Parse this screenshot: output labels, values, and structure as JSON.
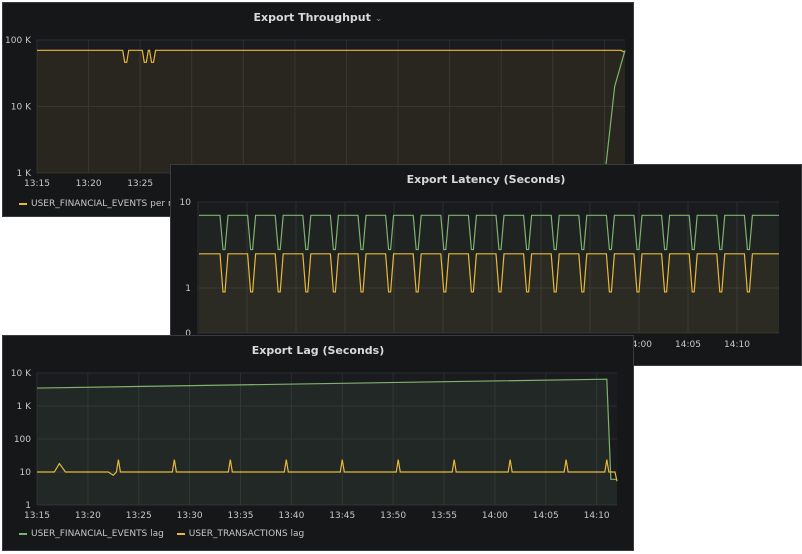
{
  "panels": {
    "throughput": {
      "title": "Export Throughput",
      "legend": [
        "USER_FINANCIAL_EVENTS per min"
      ]
    },
    "latency": {
      "title": "Export Latency (Seconds)",
      "legend": []
    },
    "lag": {
      "title": "Export Lag (Seconds)",
      "legend": [
        "USER_FINANCIAL_EVENTS lag",
        "USER_TRANSACTIONS lag"
      ]
    }
  },
  "colors": {
    "panel_bg": "#161719",
    "grid": "#2c2d30",
    "green": "#7eb26d",
    "yellow": "#eab839"
  },
  "chart_data": [
    {
      "type": "line",
      "title": "Export Throughput",
      "y_scale": "log",
      "ylim": [
        1000,
        100000
      ],
      "y_ticks": [
        "1 K",
        "10 K",
        "100 K"
      ],
      "x_ticks": [
        "13:15",
        "13:20",
        "13:25"
      ],
      "series": [
        {
          "name": "USER_FINANCIAL_EVENTS per min",
          "color": "#eab839",
          "x": [
            "13:15",
            "13:20",
            "13:25",
            "13:30",
            "13:35",
            "13:40",
            "13:45",
            "13:50",
            "13:55",
            "14:00",
            "14:05",
            "14:10",
            "14:11",
            "14:12"
          ],
          "values": [
            70000,
            70000,
            70000,
            70000,
            70000,
            70000,
            70000,
            70000,
            70000,
            70000,
            70000,
            70000,
            70000,
            70000
          ]
        },
        {
          "name": "",
          "color": "#7eb26d",
          "x": [
            "14:10",
            "14:11",
            "14:12"
          ],
          "values": [
            800,
            20000,
            70000
          ]
        }
      ]
    },
    {
      "type": "line",
      "title": "Export Latency (Seconds)",
      "y_scale": "log",
      "ylim": [
        0.3,
        10
      ],
      "y_ticks": [
        "0",
        "1",
        "10"
      ],
      "x_ticks": [
        "14:00",
        "14:05",
        "14:10"
      ],
      "series": [
        {
          "name": "",
          "color": "#7eb26d",
          "baseline": 7,
          "dip": 2.8
        },
        {
          "name": "",
          "color": "#eab839",
          "baseline": 2.5,
          "dip": 0.9
        }
      ]
    },
    {
      "type": "line",
      "title": "Export Lag (Seconds)",
      "y_scale": "log",
      "ylim": [
        1,
        10000
      ],
      "y_ticks": [
        "1",
        "10",
        "100",
        "1 K",
        "10 K"
      ],
      "x_ticks": [
        "13:15",
        "13:20",
        "13:25",
        "13:30",
        "13:35",
        "13:40",
        "13:45",
        "13:50",
        "13:55",
        "14:00",
        "14:05",
        "14:10"
      ],
      "series": [
        {
          "name": "USER_FINANCIAL_EVENTS lag",
          "color": "#7eb26d",
          "x": [
            "13:15",
            "14:11",
            "14:11.5",
            "14:12"
          ],
          "values": [
            3500,
            6500,
            6,
            6
          ]
        },
        {
          "name": "USER_TRANSACTIONS lag",
          "color": "#eab839",
          "x": [
            "13:15",
            "13:17",
            "13:18",
            "14:12"
          ],
          "values": [
            10,
            18,
            9,
            10
          ]
        }
      ]
    }
  ]
}
